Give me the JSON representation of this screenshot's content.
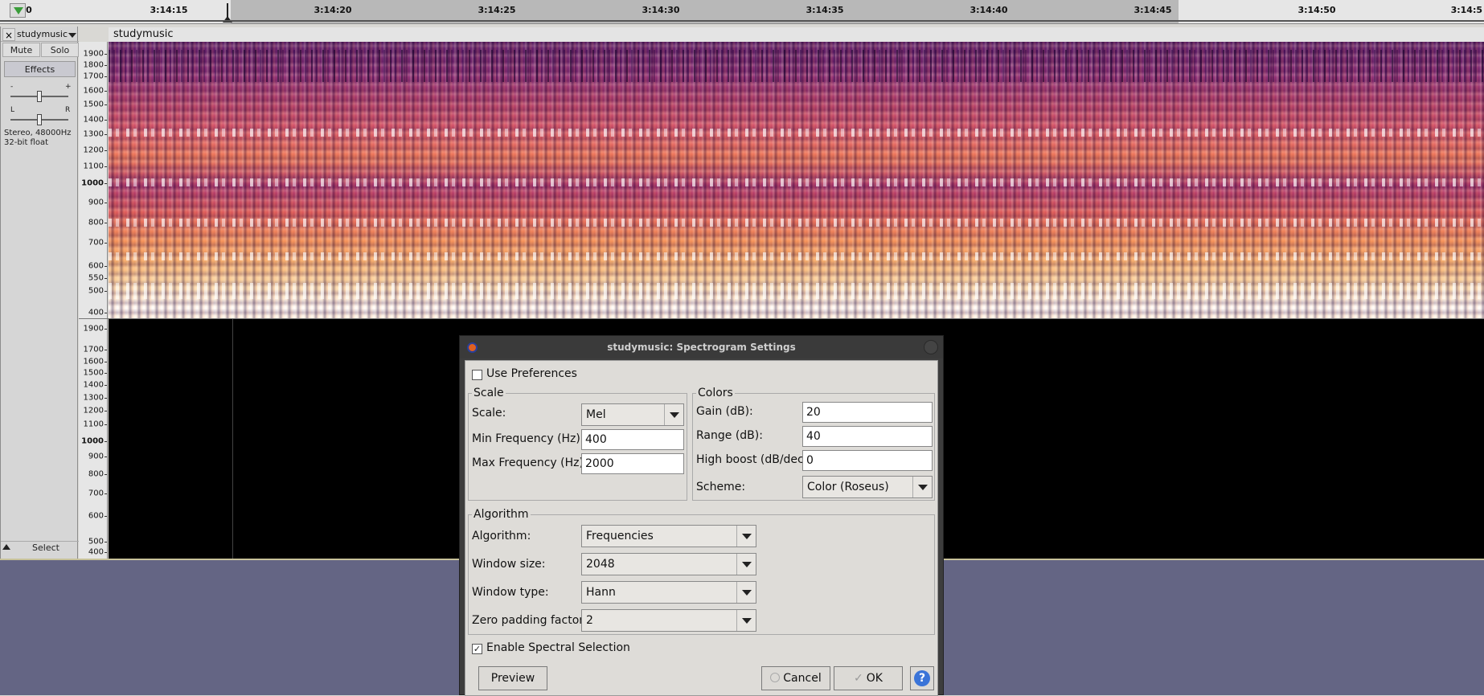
{
  "timeline": {
    "ticks": [
      "0",
      "3:14:15",
      "3:14:20",
      "3:14:25",
      "3:14:30",
      "3:14:35",
      "3:14:40",
      "3:14:45",
      "3:14:50",
      "3:14:5"
    ]
  },
  "track": {
    "name": "studymusic",
    "title": "studymusic",
    "mute": "Mute",
    "solo": "Solo",
    "effects": "Effects",
    "gain_minus": "-",
    "gain_plus": "+",
    "pan_left": "L",
    "pan_right": "R",
    "format_line1": "Stereo, 48000Hz",
    "format_line2": "32-bit float",
    "select": "Select"
  },
  "ruler_labels": [
    "1900",
    "1800",
    "1700",
    "1600",
    "1500",
    "1400",
    "1300",
    "1200",
    "1100",
    "1000",
    "900",
    "800",
    "700",
    "600",
    "550",
    "500",
    "400"
  ],
  "ruler2_labels": [
    "1900",
    "1700",
    "1600",
    "1500",
    "1400",
    "1300",
    "1200",
    "1100",
    "1000",
    "900",
    "800",
    "700",
    "600",
    "500",
    "400"
  ],
  "dialog": {
    "title": "studymusic: Spectrogram Settings",
    "use_preferences": "Use Preferences",
    "use_preferences_checked": false,
    "scale_group": "Scale",
    "scale_label": "Scale:",
    "scale_value": "Mel",
    "min_freq_label": "Min Frequency (Hz):",
    "min_freq_value": "400",
    "max_freq_label": "Max Frequency (Hz):",
    "max_freq_value": "2000",
    "colors_group": "Colors",
    "gain_label": "Gain (dB):",
    "gain_value": "20",
    "range_label": "Range (dB):",
    "range_value": "40",
    "high_boost_label": "High boost (dB/dec):",
    "high_boost_value": "0",
    "scheme_label": "Scheme:",
    "scheme_value": "Color (Roseus)",
    "algorithm_group": "Algorithm",
    "algorithm_label": "Algorithm:",
    "algorithm_value": "Frequencies",
    "window_size_label": "Window size:",
    "window_size_value": "2048",
    "window_type_label": "Window type:",
    "window_type_value": "Hann",
    "zero_padding_label": "Zero padding factor:",
    "zero_padding_value": "2",
    "spectral_selection": "Enable Spectral Selection",
    "spectral_selection_checked": true,
    "preview": "Preview",
    "cancel": "Cancel",
    "ok": "OK",
    "help": "?"
  }
}
